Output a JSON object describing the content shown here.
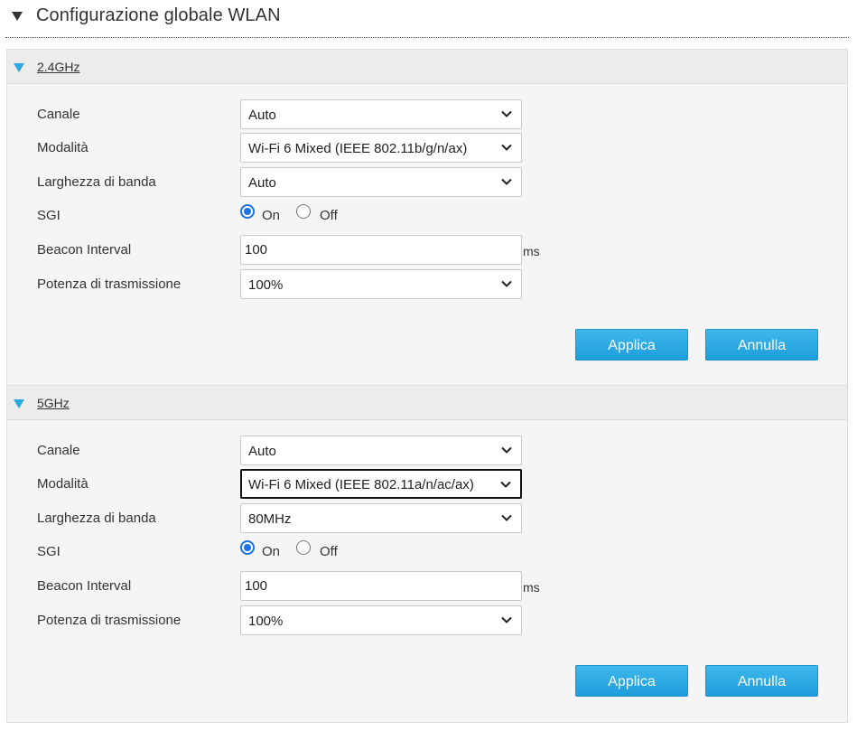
{
  "page": {
    "title": "Configurazione globale WLAN"
  },
  "panels": [
    {
      "header": "2.4GHz",
      "canale": {
        "label": "Canale",
        "value": "Auto"
      },
      "modalita": {
        "label": "Modalità",
        "value": "Wi-Fi 6 Mixed (IEEE 802.11b/g/n/ax)"
      },
      "larghezza": {
        "label": "Larghezza di banda",
        "value": "Auto"
      },
      "sgi": {
        "label": "SGI",
        "on": "On",
        "off": "Off",
        "selected": "On"
      },
      "beacon": {
        "label": "Beacon Interval",
        "value": "100",
        "unit": "ms"
      },
      "potenza": {
        "label": "Potenza di trasmissione",
        "value": "100%"
      },
      "apply": "Applica",
      "cancel": "Annulla"
    },
    {
      "header": "5GHz",
      "canale": {
        "label": "Canale",
        "value": "Auto"
      },
      "modalita": {
        "label": "Modalità",
        "value": "Wi-Fi 6 Mixed (IEEE 802.11a/n/ac/ax)"
      },
      "larghezza": {
        "label": "Larghezza di banda",
        "value": "80MHz"
      },
      "sgi": {
        "label": "SGI",
        "on": "On",
        "off": "Off",
        "selected": "On"
      },
      "beacon": {
        "label": "Beacon Interval",
        "value": "100",
        "unit": "ms"
      },
      "potenza": {
        "label": "Potenza di trasmissione",
        "value": "100%"
      },
      "apply": "Applica",
      "cancel": "Annulla"
    }
  ],
  "icons": {
    "section_toggle": "caret-down-icon",
    "panel_toggle": "caret-down-icon",
    "select": "chevron-down-icon"
  },
  "colors": {
    "accent": "#2aa9e0",
    "button": "#1d9ddb",
    "radio": "#1a73e8"
  }
}
